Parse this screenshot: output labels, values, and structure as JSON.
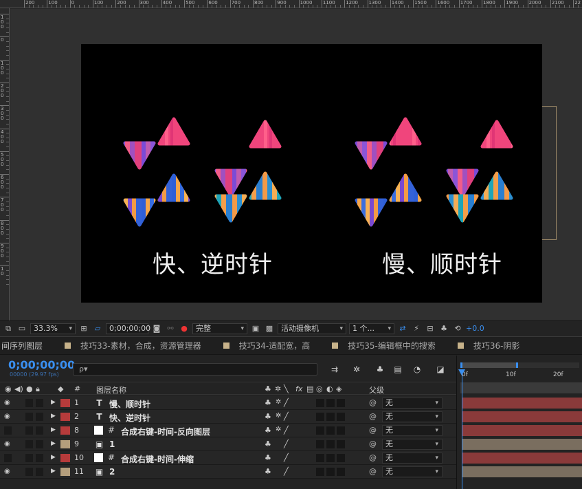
{
  "ruler": {
    "top_labels": [
      "200",
      "100",
      "0",
      "100",
      "200",
      "300",
      "400",
      "500",
      "600",
      "700",
      "800",
      "900",
      "1000",
      "1100",
      "1200",
      "1300",
      "1400",
      "1500",
      "1600",
      "1700",
      "1800",
      "1900",
      "2000",
      "2100",
      "22"
    ],
    "left_labels": [
      "100",
      "0",
      "100",
      "200",
      "300",
      "400",
      "500",
      "600",
      "700",
      "800",
      "900",
      "10"
    ]
  },
  "canvas": {
    "caption_left": "快、逆时针",
    "caption_right": "慢、顺时针"
  },
  "viewer_toolbar": {
    "zoom": "33.3%",
    "timecode": "0;00;00;00",
    "resolution": "完整",
    "camera": "活动摄像机",
    "views": "1 个...",
    "exposure": "+0.0"
  },
  "tabs": [
    {
      "label": "间序列图层",
      "swatch": false
    },
    {
      "label": "技巧33-素材，合成，资源管理器",
      "swatch": true
    },
    {
      "label": "技巧34-适配宽，高",
      "swatch": true
    },
    {
      "label": "技巧35-编辑框中的搜索",
      "swatch": true
    },
    {
      "label": "技巧36-阴影",
      "swatch": true
    }
  ],
  "timeline": {
    "timecode": "0;00;00;00",
    "fps": "00000 (29.97 fps)",
    "search_placeholder": "ρ▾",
    "columns": {
      "num": "#",
      "layer_name": "图层名称",
      "parent": "父级"
    },
    "time_ticks": [
      "0f",
      "10f",
      "20f"
    ],
    "layers": [
      {
        "num": "1",
        "type": "T",
        "name": "慢、顺时针",
        "label_color": "#b73b3b",
        "visible": true,
        "switch_kind": "text",
        "parent": "无",
        "bar_color": "#8a3a3a"
      },
      {
        "num": "2",
        "type": "T",
        "name": "快、逆时针",
        "label_color": "#b73b3b",
        "visible": true,
        "switch_kind": "text",
        "parent": "无",
        "bar_color": "#8a3a3a"
      },
      {
        "num": "8",
        "type": "solid",
        "name": "合成右键-时间-反向图层",
        "label_color": "#b73b3b",
        "visible": false,
        "switch_kind": "text",
        "parent": "无",
        "bar_color": "#8a3a3a"
      },
      {
        "num": "9",
        "type": "comp",
        "name": "1",
        "label_color": "#b49e7c",
        "visible": true,
        "switch_kind": "comp",
        "parent": "无",
        "bar_color": "#7a6e5f"
      },
      {
        "num": "10",
        "type": "solid",
        "name": "合成右键-时间-伸缩",
        "label_color": "#b73b3b",
        "visible": false,
        "switch_kind": "comp",
        "parent": "无",
        "bar_color": "#8a3a3a"
      },
      {
        "num": "11",
        "type": "comp",
        "name": "2",
        "label_color": "#b49e7c",
        "visible": true,
        "switch_kind": "comp",
        "parent": "无",
        "bar_color": "#7a6e5f"
      }
    ]
  },
  "colors": {
    "accent": "#3a8ff0",
    "label_red": "#b73b3b",
    "label_tan": "#b49e7c"
  }
}
